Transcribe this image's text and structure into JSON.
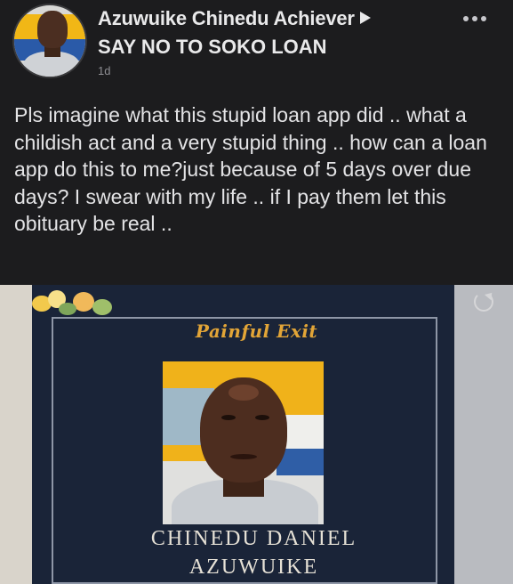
{
  "post": {
    "author": "Azuwuike Chinedu Achiever",
    "group": "SAY NO TO SOKO LOAN",
    "timestamp": "1d",
    "more_icon": "more-options-icon",
    "text": "Pls imagine what this stupid loan app did .. what a childish act and a very stupid thing .. how can a loan app do this to me?just because of 5 days over due days? I swear with my life .. if I pay them let this obituary be real .."
  },
  "obituary": {
    "heading": "Painful Exit",
    "name_line1": "CHINEDU DANIEL",
    "name_line2": "AZUWUIKE"
  },
  "colors": {
    "background": "#1c1c1e",
    "text": "#e3e3e5",
    "heading_gold": "#e2a537",
    "board_navy": "#1a2438"
  }
}
